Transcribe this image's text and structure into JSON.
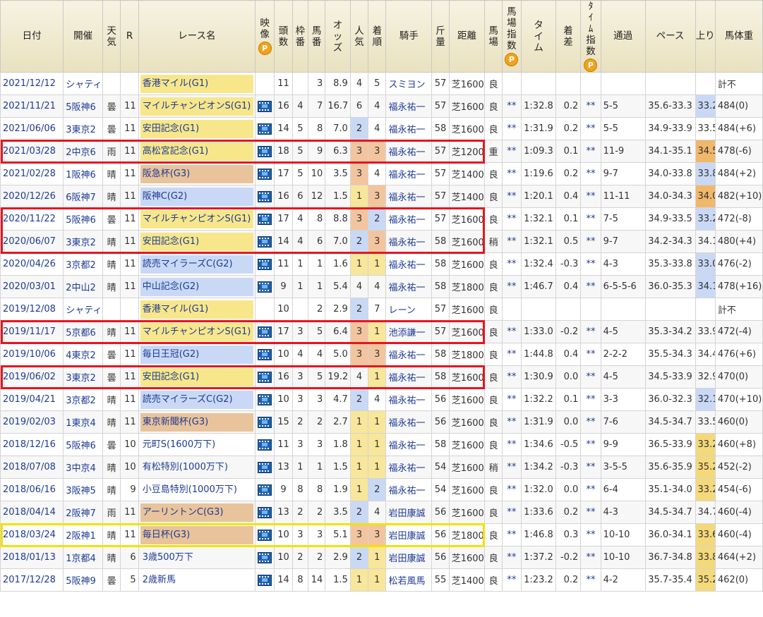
{
  "colors": {
    "red_box": "#e8141e",
    "yellow_box": "#f2e200",
    "g1": "#f7e78a",
    "g2": "#c9d9f5",
    "g3": "#e8c39b",
    "link": "#1d3a94"
  },
  "headers": {
    "date": "日付",
    "venue": "開催",
    "weather": "天気",
    "r": "R",
    "race": "レース名",
    "video": "映像",
    "runners": "頭数",
    "frame": "枠番",
    "horse": "馬番",
    "odds": "オッズ",
    "pop": "人気",
    "place": "着順",
    "jockey": "騎手",
    "weight": "斤量",
    "dist": "距離",
    "track": "馬場",
    "track_idx": "馬場指数",
    "time": "タイム",
    "margin": "着差",
    "time_idx": "ﾀｲﾑ指数",
    "pass": "通過",
    "pace": "ペース",
    "up": "上り",
    "bw": "馬体重",
    "p_badge": "P"
  },
  "rows": [
    {
      "date": "2021/12/12",
      "venue": "シャティ",
      "weather": "",
      "r": "",
      "race": "香港マイル(G1)",
      "grade": "g1",
      "video": false,
      "n": "11",
      "frame": "",
      "horse": "3",
      "odds": "8.9",
      "pop": "4",
      "place": "5",
      "jockey": "スミヨン",
      "wt": "57",
      "dist": "芝1600",
      "track": "良",
      "ti": "",
      "time": "",
      "margin": "",
      "tix": "",
      "pass": "",
      "pace": "",
      "up": "",
      "bw": "計不"
    },
    {
      "date": "2021/11/21",
      "venue": "5阪神6",
      "weather": "曇",
      "r": "11",
      "race": "マイルチャンピオンS(G1)",
      "grade": "g1",
      "video": true,
      "n": "16",
      "frame": "4",
      "horse": "7",
      "odds": "16.7",
      "pop": "6",
      "place": "4",
      "jockey": "福永祐一",
      "wt": "57",
      "dist": "芝1600",
      "track": "良",
      "ti": "**",
      "time": "1:32.8",
      "margin": "0.2",
      "tix": "**",
      "pass": "5-5",
      "pace": "35.6-33.3",
      "up": "33.2",
      "bw": "484(0)"
    },
    {
      "date": "2021/06/06",
      "venue": "3東京2",
      "weather": "曇",
      "r": "11",
      "race": "安田記念(G1)",
      "grade": "g1",
      "video": true,
      "n": "14",
      "frame": "5",
      "horse": "8",
      "odds": "7.0",
      "pop": "2",
      "place": "4",
      "jockey": "福永祐一",
      "wt": "58",
      "dist": "芝1600",
      "track": "良",
      "ti": "**",
      "time": "1:31.9",
      "margin": "0.2",
      "tix": "**",
      "pass": "5-5",
      "pace": "34.9-33.9",
      "up": "33.5",
      "bw": "484(+6)"
    },
    {
      "date": "2021/03/28",
      "venue": "2中京6",
      "weather": "雨",
      "r": "11",
      "race": "高松宮記念(G1)",
      "grade": "g1",
      "video": true,
      "n": "18",
      "frame": "5",
      "horse": "9",
      "odds": "6.3",
      "pop": "3",
      "place": "3",
      "jockey": "福永祐一",
      "wt": "57",
      "dist": "芝1200",
      "track": "重",
      "ti": "**",
      "time": "1:09.3",
      "margin": "0.1",
      "tix": "**",
      "pass": "11-9",
      "pace": "34.1-35.1",
      "up": "34.5",
      "bw": "478(-6)"
    },
    {
      "date": "2021/02/28",
      "venue": "1阪神6",
      "weather": "晴",
      "r": "11",
      "race": "阪急杯(G3)",
      "grade": "g3",
      "video": true,
      "n": "17",
      "frame": "5",
      "horse": "10",
      "odds": "3.5",
      "pop": "3",
      "place": "4",
      "jockey": "福永祐一",
      "wt": "57",
      "dist": "芝1400",
      "track": "良",
      "ti": "**",
      "time": "1:19.6",
      "margin": "0.2",
      "tix": "**",
      "pass": "9-7",
      "pace": "34.0-33.8",
      "up": "33.8",
      "bw": "484(+2)"
    },
    {
      "date": "2020/12/26",
      "venue": "6阪神7",
      "weather": "晴",
      "r": "11",
      "race": "阪神C(G2)",
      "grade": "g2",
      "video": true,
      "n": "16",
      "frame": "6",
      "horse": "12",
      "odds": "1.5",
      "pop": "1",
      "place": "3",
      "jockey": "福永祐一",
      "wt": "57",
      "dist": "芝1400",
      "track": "良",
      "ti": "**",
      "time": "1:20.1",
      "margin": "0.4",
      "tix": "**",
      "pass": "11-11",
      "pace": "34.0-34.3",
      "up": "34.0",
      "bw": "482(+10)"
    },
    {
      "date": "2020/11/22",
      "venue": "5阪神6",
      "weather": "曇",
      "r": "11",
      "race": "マイルチャンピオンS(G1)",
      "grade": "g1",
      "video": true,
      "n": "17",
      "frame": "4",
      "horse": "8",
      "odds": "8.8",
      "pop": "3",
      "place": "2",
      "jockey": "福永祐一",
      "wt": "57",
      "dist": "芝1600",
      "track": "良",
      "ti": "**",
      "time": "1:32.1",
      "margin": "0.1",
      "tix": "**",
      "pass": "7-5",
      "pace": "34.9-33.5",
      "up": "33.2",
      "bw": "472(-8)"
    },
    {
      "date": "2020/06/07",
      "venue": "3東京2",
      "weather": "晴",
      "r": "11",
      "race": "安田記念(G1)",
      "grade": "g1",
      "video": true,
      "n": "14",
      "frame": "4",
      "horse": "6",
      "odds": "7.0",
      "pop": "2",
      "place": "3",
      "jockey": "福永祐一",
      "wt": "58",
      "dist": "芝1600",
      "track": "稍",
      "ti": "**",
      "time": "1:32.1",
      "margin": "0.5",
      "tix": "**",
      "pass": "9-7",
      "pace": "34.2-34.3",
      "up": "34.1",
      "bw": "480(+4)"
    },
    {
      "date": "2020/04/26",
      "venue": "3京都2",
      "weather": "晴",
      "r": "11",
      "race": "読売マイラーズC(G2)",
      "grade": "g2",
      "video": true,
      "n": "11",
      "frame": "1",
      "horse": "1",
      "odds": "1.6",
      "pop": "1",
      "place": "1",
      "jockey": "福永祐一",
      "wt": "58",
      "dist": "芝1600",
      "track": "良",
      "ti": "**",
      "time": "1:32.4",
      "margin": "-0.3",
      "tix": "**",
      "pass": "4-3",
      "pace": "35.3-33.8",
      "up": "33.0",
      "bw": "476(-2)"
    },
    {
      "date": "2020/03/01",
      "venue": "2中山2",
      "weather": "晴",
      "r": "11",
      "race": "中山記念(G2)",
      "grade": "g2",
      "video": true,
      "n": "9",
      "frame": "1",
      "horse": "1",
      "odds": "5.4",
      "pop": "4",
      "place": "4",
      "jockey": "福永祐一",
      "wt": "58",
      "dist": "芝1800",
      "track": "良",
      "ti": "**",
      "time": "1:46.7",
      "margin": "0.4",
      "tix": "**",
      "pass": "6-5-5-6",
      "pace": "36.0-35.3",
      "up": "34.1",
      "bw": "478(+16)"
    },
    {
      "date": "2019/12/08",
      "venue": "シャティ",
      "weather": "",
      "r": "",
      "race": "香港マイル(G1)",
      "grade": "g1",
      "video": false,
      "n": "10",
      "frame": "",
      "horse": "2",
      "odds": "2.9",
      "pop": "2",
      "place": "7",
      "jockey": "レーン",
      "wt": "57",
      "dist": "芝1600",
      "track": "良",
      "ti": "",
      "time": "",
      "margin": "",
      "tix": "",
      "pass": "",
      "pace": "",
      "up": "",
      "bw": "計不"
    },
    {
      "date": "2019/11/17",
      "venue": "5京都6",
      "weather": "晴",
      "r": "11",
      "race": "マイルチャンピオンS(G1)",
      "grade": "g1",
      "video": true,
      "n": "17",
      "frame": "3",
      "horse": "5",
      "odds": "6.4",
      "pop": "3",
      "place": "1",
      "jockey": "池添謙一",
      "wt": "57",
      "dist": "芝1600",
      "track": "良",
      "ti": "**",
      "time": "1:33.0",
      "margin": "-0.2",
      "tix": "**",
      "pass": "4-5",
      "pace": "35.3-34.2",
      "up": "33.9",
      "bw": "472(-4)"
    },
    {
      "date": "2019/10/06",
      "venue": "4東京2",
      "weather": "曇",
      "r": "11",
      "race": "毎日王冠(G2)",
      "grade": "g2",
      "video": true,
      "n": "10",
      "frame": "4",
      "horse": "4",
      "odds": "5.0",
      "pop": "3",
      "place": "3",
      "jockey": "福永祐一",
      "wt": "58",
      "dist": "芝1800",
      "track": "良",
      "ti": "**",
      "time": "1:44.8",
      "margin": "0.4",
      "tix": "**",
      "pass": "2-2-2",
      "pace": "35.5-34.3",
      "up": "34.4",
      "bw": "476(+6)"
    },
    {
      "date": "2019/06/02",
      "venue": "3東京2",
      "weather": "曇",
      "r": "11",
      "race": "安田記念(G1)",
      "grade": "g1",
      "video": true,
      "n": "16",
      "frame": "3",
      "horse": "5",
      "odds": "19.2",
      "pop": "4",
      "place": "1",
      "jockey": "福永祐一",
      "wt": "58",
      "dist": "芝1600",
      "track": "良",
      "ti": "**",
      "time": "1:30.9",
      "margin": "0.0",
      "tix": "**",
      "pass": "4-5",
      "pace": "34.5-33.9",
      "up": "32.9",
      "bw": "470(0)"
    },
    {
      "date": "2019/04/21",
      "venue": "3京都2",
      "weather": "晴",
      "r": "11",
      "race": "読売マイラーズC(G2)",
      "grade": "g2",
      "video": true,
      "n": "10",
      "frame": "3",
      "horse": "3",
      "odds": "4.7",
      "pop": "2",
      "place": "4",
      "jockey": "福永祐一",
      "wt": "56",
      "dist": "芝1600",
      "track": "良",
      "ti": "**",
      "time": "1:32.2",
      "margin": "0.1",
      "tix": "**",
      "pass": "3-3",
      "pace": "36.0-32.3",
      "up": "32.1",
      "bw": "470(+10)"
    },
    {
      "date": "2019/02/03",
      "venue": "1東京4",
      "weather": "晴",
      "r": "11",
      "race": "東京新聞杯(G3)",
      "grade": "g3",
      "video": true,
      "n": "15",
      "frame": "2",
      "horse": "2",
      "odds": "2.7",
      "pop": "1",
      "place": "1",
      "jockey": "福永祐一",
      "wt": "56",
      "dist": "芝1600",
      "track": "良",
      "ti": "**",
      "time": "1:31.9",
      "margin": "0.0",
      "tix": "**",
      "pass": "7-6",
      "pace": "34.5-34.7",
      "up": "33.5",
      "bw": "460(0)"
    },
    {
      "date": "2018/12/16",
      "venue": "5阪神6",
      "weather": "曇",
      "r": "10",
      "race": "元町S(1600万下)",
      "grade": "plain",
      "video": true,
      "n": "11",
      "frame": "3",
      "horse": "3",
      "odds": "1.8",
      "pop": "1",
      "place": "1",
      "jockey": "福永祐一",
      "wt": "58",
      "dist": "芝1600",
      "track": "良",
      "ti": "**",
      "time": "1:34.6",
      "margin": "-0.5",
      "tix": "**",
      "pass": "9-9",
      "pace": "36.5-33.9",
      "up": "33.2",
      "bw": "460(+8)"
    },
    {
      "date": "2018/07/08",
      "venue": "3中京4",
      "weather": "晴",
      "r": "10",
      "race": "有松特別(1000万下)",
      "grade": "plain",
      "video": true,
      "n": "13",
      "frame": "1",
      "horse": "1",
      "odds": "1.5",
      "pop": "1",
      "place": "1",
      "jockey": "福永祐一",
      "wt": "54",
      "dist": "芝1600",
      "track": "稍",
      "ti": "**",
      "time": "1:34.2",
      "margin": "-0.3",
      "tix": "**",
      "pass": "3-5-5",
      "pace": "35.6-35.9",
      "up": "35.2",
      "bw": "452(-2)"
    },
    {
      "date": "2018/06/16",
      "venue": "3阪神5",
      "weather": "晴",
      "r": "9",
      "race": "小豆島特別(1000万下)",
      "grade": "plain",
      "video": true,
      "n": "9",
      "frame": "8",
      "horse": "8",
      "odds": "1.9",
      "pop": "1",
      "place": "2",
      "jockey": "福永祐一",
      "wt": "54",
      "dist": "芝1600",
      "track": "良",
      "ti": "**",
      "time": "1:32.0",
      "margin": "0.0",
      "tix": "**",
      "pass": "6-4",
      "pace": "35.1-34.0",
      "up": "33.2",
      "bw": "454(-6)"
    },
    {
      "date": "2018/04/14",
      "venue": "2阪神7",
      "weather": "雨",
      "r": "11",
      "race": "アーリントンC(G3)",
      "grade": "g3",
      "video": true,
      "n": "13",
      "frame": "2",
      "horse": "2",
      "odds": "3.5",
      "pop": "2",
      "place": "4",
      "jockey": "岩田康誠",
      "wt": "56",
      "dist": "芝1600",
      "track": "良",
      "ti": "**",
      "time": "1:33.6",
      "margin": "0.2",
      "tix": "**",
      "pass": "4-3",
      "pace": "34.5-34.7",
      "up": "34.7",
      "bw": "460(-4)"
    },
    {
      "date": "2018/03/24",
      "venue": "2阪神1",
      "weather": "晴",
      "r": "11",
      "race": "毎日杯(G3)",
      "grade": "g3",
      "video": true,
      "n": "10",
      "frame": "3",
      "horse": "3",
      "odds": "5.1",
      "pop": "3",
      "place": "3",
      "jockey": "岩田康誠",
      "wt": "56",
      "dist": "芝1800",
      "track": "良",
      "ti": "**",
      "time": "1:46.8",
      "margin": "0.3",
      "tix": "**",
      "pass": "10-10",
      "pace": "36.0-34.1",
      "up": "33.6",
      "bw": "460(-4)"
    },
    {
      "date": "2018/01/13",
      "venue": "1京都4",
      "weather": "晴",
      "r": "6",
      "race": "3歳500万下",
      "grade": "plain",
      "video": true,
      "n": "10",
      "frame": "2",
      "horse": "2",
      "odds": "2.9",
      "pop": "2",
      "place": "1",
      "jockey": "岩田康誠",
      "wt": "56",
      "dist": "芝1600",
      "track": "良",
      "ti": "**",
      "time": "1:37.2",
      "margin": "-0.2",
      "tix": "**",
      "pass": "10-10",
      "pace": "36.7-34.8",
      "up": "33.8",
      "bw": "464(+2)"
    },
    {
      "date": "2017/12/28",
      "venue": "5阪神9",
      "weather": "曇",
      "r": "5",
      "race": "2歳新馬",
      "grade": "plain",
      "video": true,
      "n": "14",
      "frame": "8",
      "horse": "14",
      "odds": "1.5",
      "pop": "1",
      "place": "1",
      "jockey": "松若風馬",
      "wt": "55",
      "dist": "芝1400",
      "track": "良",
      "ti": "**",
      "time": "1:23.2",
      "margin": "0.2",
      "tix": "**",
      "pass": "4-2",
      "pace": "35.7-35.4",
      "up": "35.2",
      "bw": "462(0)"
    }
  ],
  "pop_colors": [
    "",
    "pop1",
    "pop2",
    "pop3"
  ],
  "up_marks": [
    "",
    "upB",
    "",
    "upO",
    "upB",
    "upO",
    "upB",
    "",
    "upB",
    "upB",
    "",
    "",
    "",
    "",
    "upB",
    "",
    "upY",
    "upY",
    "upY",
    "",
    "upY",
    "upY",
    "upY"
  ]
}
